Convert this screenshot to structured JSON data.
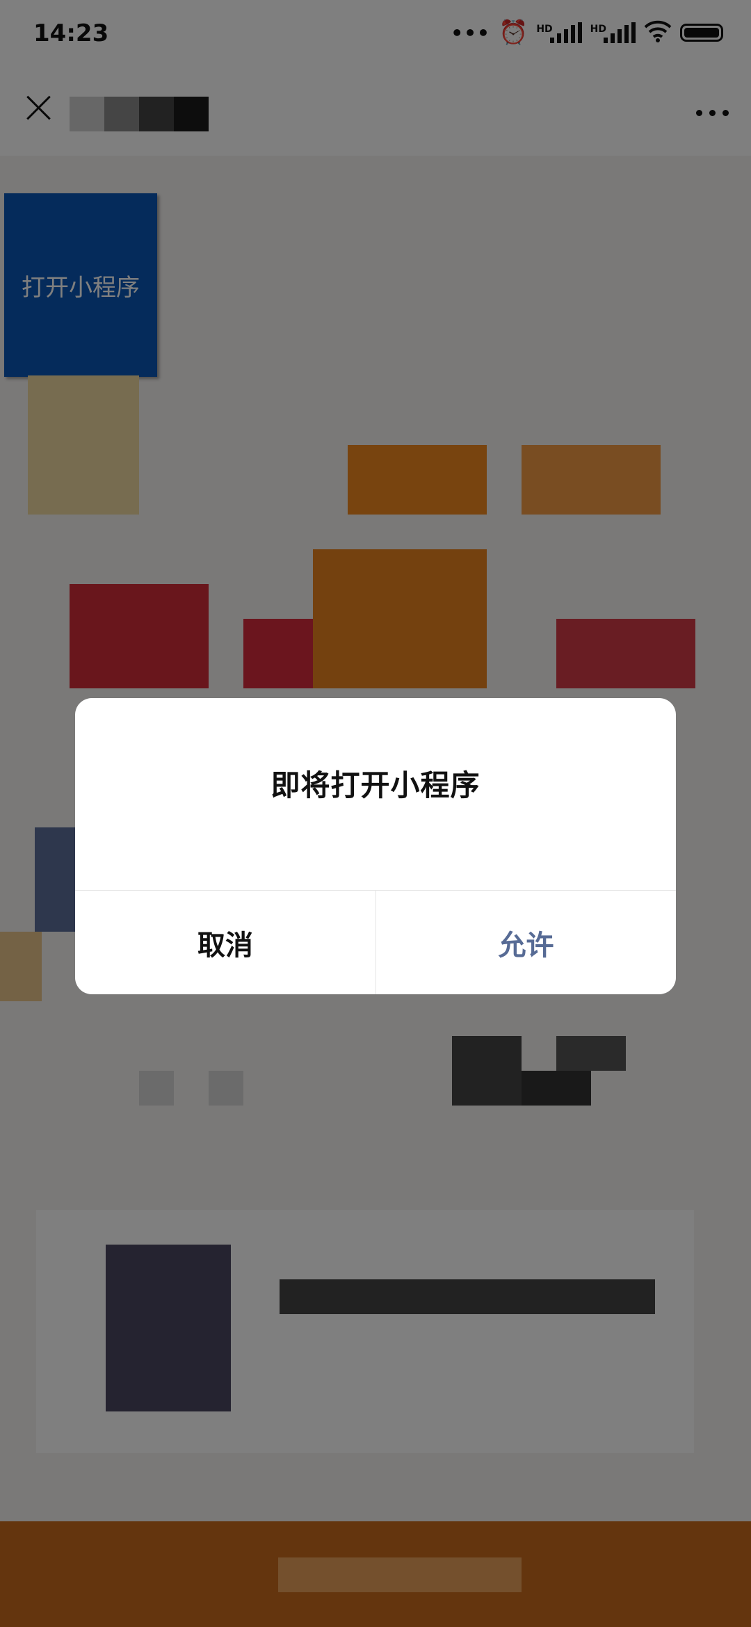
{
  "status_bar": {
    "time": "14:23",
    "icons": [
      "more-dots-icon",
      "alarm-icon",
      "hd-signal-icon",
      "hd-signal-icon",
      "wifi-icon",
      "battery-icon"
    ]
  },
  "title_bar": {
    "close_icon": "close-icon",
    "menu_icon": "more-icon"
  },
  "page": {
    "open_miniprogram_button": "打开小程序"
  },
  "dialog": {
    "title": "即将打开小程序",
    "cancel_label": "取消",
    "allow_label": "允许",
    "allow_color": "#576b95"
  },
  "colors": {
    "open_button": "#0a57b6",
    "footer": "#c86a1c"
  }
}
